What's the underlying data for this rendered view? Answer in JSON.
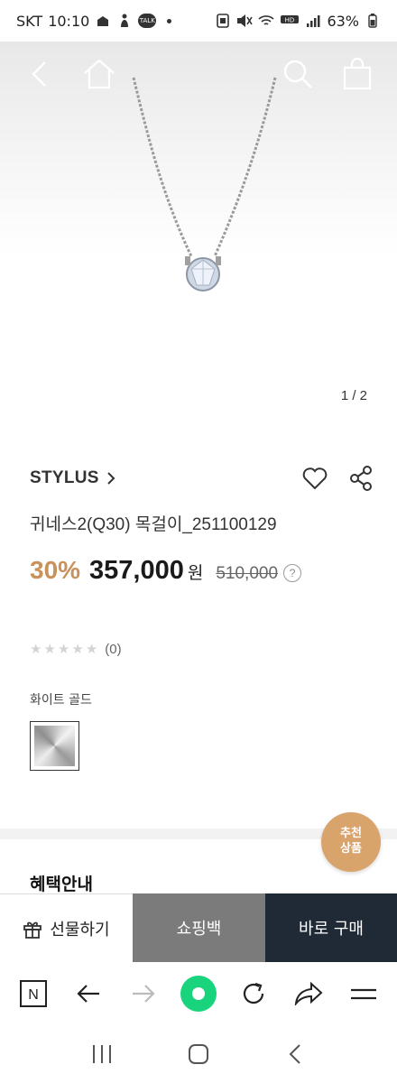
{
  "status_bar": {
    "carrier": "SKT",
    "time": "10:10",
    "talk_badge": "TALK",
    "hd_badge": "HD",
    "battery": "63%"
  },
  "nav": {
    "back_icon": "chevron-left-icon",
    "home_icon": "home-icon",
    "search_icon": "search-icon",
    "cart_icon": "shopping-bag-icon"
  },
  "gallery": {
    "pager": "1 / 2"
  },
  "product": {
    "brand": "STYLUS",
    "brand_chevron": "›",
    "name": "귀네스2(Q30) 목걸이_251100129",
    "discount": "30%",
    "price": "357,000",
    "currency": "원",
    "original_price": "510,000",
    "help": "?",
    "rating_count": "(0)",
    "option_label": "화이트 골드"
  },
  "sections": {
    "benefit_title": "혜택안내"
  },
  "recommend_badge": {
    "line1": "추천",
    "line2": "상품"
  },
  "buy_bar": {
    "gift": "선물하기",
    "cart": "쇼핑백",
    "buy": "바로 구매"
  },
  "browser_bar": {
    "n_label": "N"
  },
  "colors": {
    "discount": "#c8925a",
    "cart_bg": "#7b7b7b",
    "buy_bg": "#1f2a36",
    "recommend_bg": "#d9a36c",
    "browser_green": "#19d47c"
  }
}
